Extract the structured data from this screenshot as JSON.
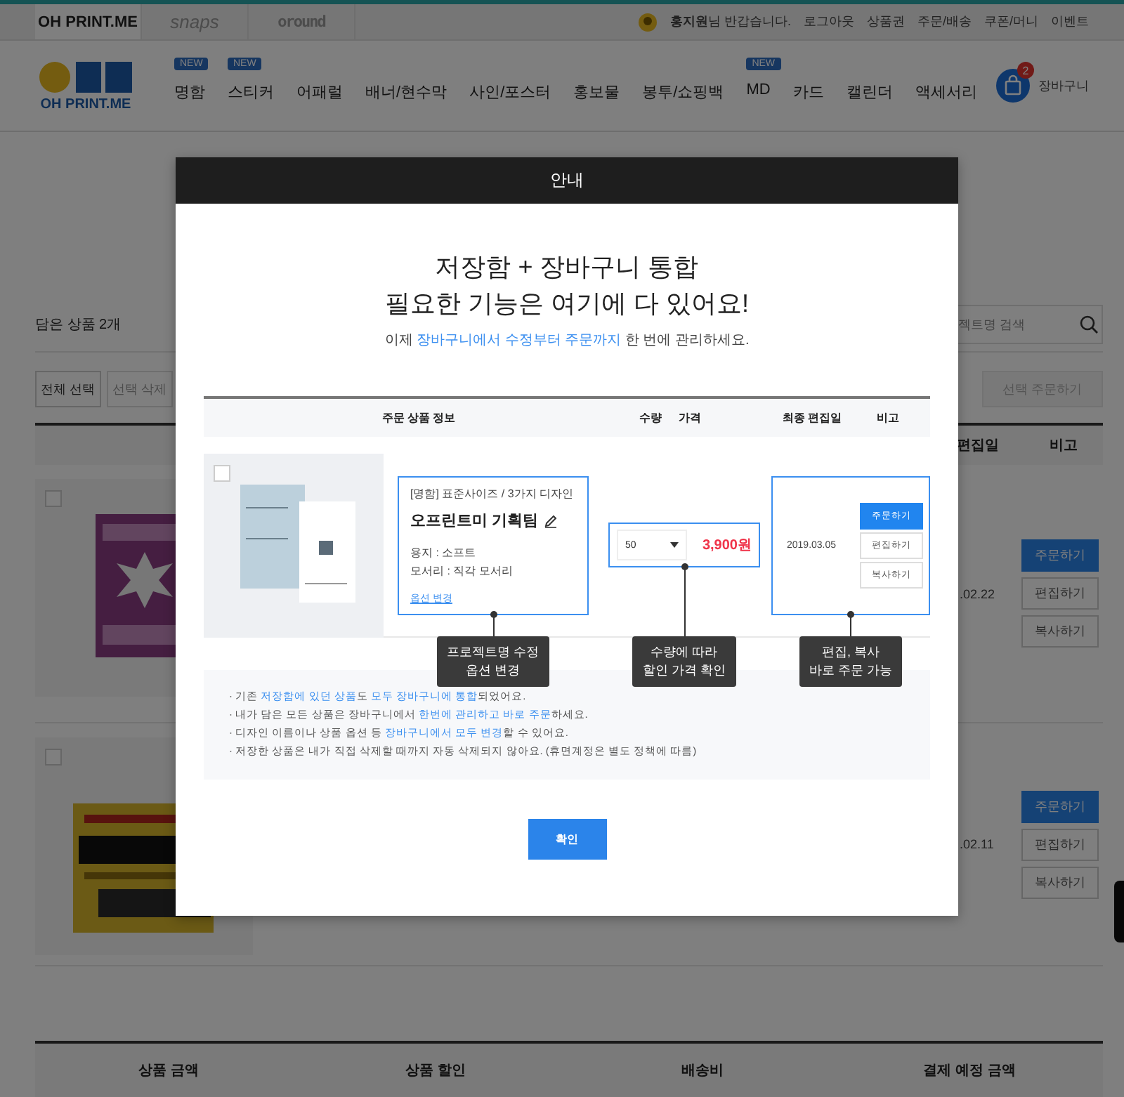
{
  "top_bar": {
    "sites": [
      {
        "label": "OH PRINT.ME",
        "selected": true
      },
      {
        "label": "snaps",
        "selected": false
      },
      {
        "label": "oround",
        "selected": false
      }
    ],
    "greeting": "**홍지원**님 반갑습니다.",
    "links": [
      "로그아웃",
      "상품권",
      "주문/배송",
      "쿠폰/머니",
      "이벤트"
    ]
  },
  "nav": {
    "logo": "OH PRINT.ME",
    "menu": [
      {
        "label": "명함",
        "badge": "NEW"
      },
      {
        "label": "스티커",
        "badge": "NEW"
      },
      {
        "label": "어패럴"
      },
      {
        "label": "배너/현수막"
      },
      {
        "label": "사인/포스터"
      },
      {
        "label": "홍보물"
      },
      {
        "label": "봉투/쇼핑백"
      },
      {
        "label": "MD",
        "badge": "NEW"
      },
      {
        "label": "카드"
      },
      {
        "label": "캘린더"
      },
      {
        "label": "액세서리"
      }
    ],
    "cart": {
      "count": "2",
      "label": "장바구니"
    }
  },
  "cart_page": {
    "count_label": "담은 상품 2개",
    "search": {
      "placeholder": "젝트명 검색"
    },
    "actions": [
      "전체 선택",
      "선택 삭제"
    ],
    "order_selected": "선택 주문하기",
    "columns": [
      "편집일",
      "비고"
    ],
    "rows": [
      {
        "checked": false,
        "date": ".02.22",
        "buttons": [
          {
            "label": "주문하기",
            "primary": true
          },
          {
            "label": "편집하기",
            "primary": false
          },
          {
            "label": "복사하기",
            "primary": false
          }
        ]
      },
      {
        "checked": false,
        "date": ".02.11",
        "buttons": [
          {
            "label": "주문하기",
            "primary": true
          },
          {
            "label": "편집하기",
            "primary": false
          },
          {
            "label": "복사하기",
            "primary": false
          }
        ]
      }
    ],
    "summary": [
      "상품 금액",
      "상품 할인",
      "배송비",
      "결제 예정 금액"
    ]
  },
  "modal": {
    "title": "안내",
    "heading": [
      "저장함 + 장바구니 통합",
      "필요한 기능은 여기에 다 있어요!"
    ],
    "subtitle": "이제 **장바구니에서 수정부터 주문까지** 한 번에 관리하세요.",
    "columns": [
      "주문 상품 정보",
      "수량",
      "가격",
      "최종 편집일",
      "비고"
    ],
    "example": {
      "checked": false,
      "category": "[명함] 표준사이즈 / 3가지 디자인",
      "name": "오프린트미 기획팀",
      "options": [
        "용지 : 소프트",
        "모서리 : 직각 모서리"
      ],
      "option_link": "옵션 변경",
      "quantity": "50",
      "price": "3,900원",
      "date": "2019.03.05",
      "buttons": [
        {
          "label": "주문하기",
          "primary": true
        },
        {
          "label": "편집하기",
          "primary": false
        },
        {
          "label": "복사하기",
          "primary": false
        }
      ]
    },
    "callouts": [
      "프로젝트명 수정\n옵션 변경",
      "수량에 따라\n할인 가격 확인",
      "편집, 복사\n바로 주문 가능"
    ],
    "notes": [
      "· 기존 **저장함에 있던 상품**도 **모두 장바구니에 통합**되었어요.",
      "· 내가 담은 모든 상품은 장바구니에서 **한번에 관리하고 바로 주문**하세요.",
      "· 디자인 이름이나 상품 옵션 등 **장바구니에서 모두 변경**할 수 있어요.",
      "· 저장한 상품은 내가 직접 삭제할 때까지 자동 삭제되지 않아요. (휴면계정은 별도 정책에 따름)"
    ],
    "confirm": "확인"
  }
}
